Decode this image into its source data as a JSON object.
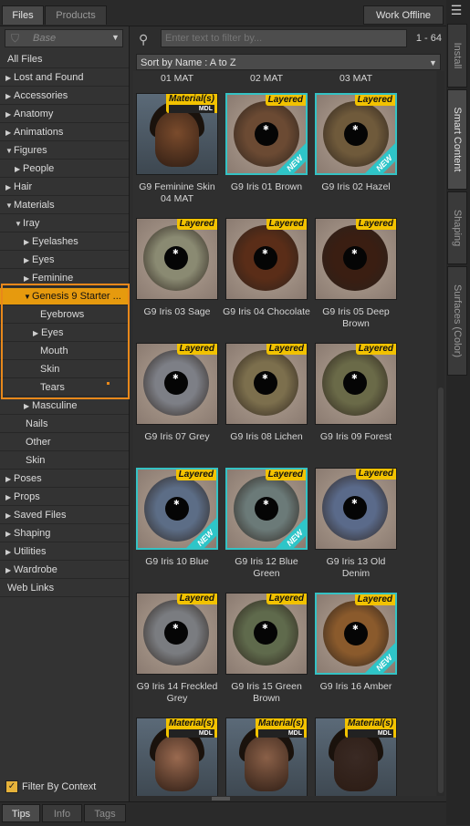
{
  "top_tabs": [
    {
      "label": "Files"
    },
    {
      "label": "Products"
    }
  ],
  "work_offline": "Work Offline",
  "filter_select": {
    "value": "Base"
  },
  "tree": [
    {
      "label": "All Files",
      "depth": 0,
      "arrow": ""
    },
    {
      "label": "Lost and Found",
      "depth": 0,
      "arrow": "▶"
    },
    {
      "label": "Accessories",
      "depth": 0,
      "arrow": "▶"
    },
    {
      "label": "Anatomy",
      "depth": 0,
      "arrow": "▶"
    },
    {
      "label": "Animations",
      "depth": 0,
      "arrow": "▶"
    },
    {
      "label": "Figures",
      "depth": 0,
      "arrow": "▼"
    },
    {
      "label": "People",
      "depth": 1,
      "arrow": "▶"
    },
    {
      "label": "Hair",
      "depth": 0,
      "arrow": "▶"
    },
    {
      "label": "Materials",
      "depth": 0,
      "arrow": "▼"
    },
    {
      "label": "Iray",
      "depth": 1,
      "arrow": "▼"
    },
    {
      "label": "Eyelashes",
      "depth": 2,
      "arrow": "▶"
    },
    {
      "label": "Eyes",
      "depth": 2,
      "arrow": "▶"
    },
    {
      "label": "Feminine",
      "depth": 2,
      "arrow": "▶"
    },
    {
      "label": "Genesis 9 Starter ...",
      "depth": 2,
      "arrow": "▼",
      "selected": true
    },
    {
      "label": "Eyebrows",
      "depth": 3,
      "arrow": ""
    },
    {
      "label": "Eyes",
      "depth": 3,
      "arrow": "▶"
    },
    {
      "label": "Mouth",
      "depth": 3,
      "arrow": ""
    },
    {
      "label": "Skin",
      "depth": 3,
      "arrow": ""
    },
    {
      "label": "Tears",
      "depth": 3,
      "arrow": ""
    },
    {
      "label": "Masculine",
      "depth": 2,
      "arrow": "▶"
    },
    {
      "label": "Nails",
      "depth": 2,
      "arrow": ""
    },
    {
      "label": "Other",
      "depth": 2,
      "arrow": ""
    },
    {
      "label": "Skin",
      "depth": 2,
      "arrow": ""
    },
    {
      "label": "Poses",
      "depth": 0,
      "arrow": "▶"
    },
    {
      "label": "Props",
      "depth": 0,
      "arrow": "▶"
    },
    {
      "label": "Saved Files",
      "depth": 0,
      "arrow": "▶"
    },
    {
      "label": "Shaping",
      "depth": 0,
      "arrow": "▶"
    },
    {
      "label": "Utilities",
      "depth": 0,
      "arrow": "▶"
    },
    {
      "label": "Wardrobe",
      "depth": 0,
      "arrow": "▶"
    },
    {
      "label": "Web Links",
      "depth": 0,
      "arrow": ""
    }
  ],
  "filter_by_context": {
    "label": "Filter By Context",
    "checked": true
  },
  "search": {
    "placeholder": "Enter text to filter by..."
  },
  "result_range": "1 - 64",
  "sort": {
    "value": "Sort by Name : A to Z"
  },
  "partial_labels": [
    "01 MAT",
    "02 MAT",
    "03 MAT"
  ],
  "items": [
    {
      "label": "G9 Feminine Skin 04 MAT",
      "kind": "person",
      "badge": "Material(s)",
      "badge_sub": "MDL",
      "teal": false,
      "new": false,
      "skin": "#7a4b2c"
    },
    {
      "label": "G9 Iris 01 Brown",
      "kind": "eye",
      "badge": "Layered",
      "teal": true,
      "new": true,
      "iris": "#6b4a33"
    },
    {
      "label": "G9 Iris 02 Hazel",
      "kind": "eye",
      "badge": "Layered",
      "teal": true,
      "new": true,
      "iris": "#6f5a3b"
    },
    {
      "label": "G9 Iris 03 Sage",
      "kind": "eye",
      "badge": "Layered",
      "teal": false,
      "new": false,
      "iris": "#8a8a72"
    },
    {
      "label": "G9 Iris 04 Chocolate",
      "kind": "eye",
      "badge": "Layered",
      "teal": false,
      "new": false,
      "iris": "#5a2d18"
    },
    {
      "label": "G9 Iris 05 Deep Brown",
      "kind": "eye",
      "badge": "Layered",
      "teal": false,
      "new": false,
      "iris": "#3a1e12"
    },
    {
      "label": "G9 Iris 07 Grey",
      "kind": "eye",
      "badge": "Layered",
      "teal": false,
      "new": false,
      "iris": "#7d7f86"
    },
    {
      "label": "G9 Iris 08 Lichen",
      "kind": "eye",
      "badge": "Layered",
      "teal": false,
      "new": false,
      "iris": "#7c6f4d"
    },
    {
      "label": "G9 Iris 09 Forest",
      "kind": "eye",
      "badge": "Layered",
      "teal": false,
      "new": false,
      "iris": "#6a6a48"
    },
    {
      "label": "G9 Iris 10 Blue",
      "kind": "eye",
      "badge": "Layered",
      "teal": true,
      "new": true,
      "iris": "#5c6d86"
    },
    {
      "label": "G9 Iris 12 Blue Green",
      "kind": "eye",
      "badge": "Layered",
      "teal": true,
      "new": true,
      "iris": "#6b7a78"
    },
    {
      "label": "G9 Iris 13 Old Denim",
      "kind": "eye",
      "badge": "Layered",
      "teal": false,
      "new": false,
      "iris": "#5a6a8a"
    },
    {
      "label": "G9 Iris 14 Freckled Grey",
      "kind": "eye",
      "badge": "Layered",
      "teal": false,
      "new": false,
      "iris": "#7a7c80"
    },
    {
      "label": "G9 Iris 15 Green Brown",
      "kind": "eye",
      "badge": "Layered",
      "teal": false,
      "new": false,
      "iris": "#5f6a4c"
    },
    {
      "label": "G9 Iris 16 Amber",
      "kind": "eye",
      "badge": "Layered",
      "teal": true,
      "new": true,
      "iris": "#8a5a2c"
    },
    {
      "label": "",
      "kind": "person",
      "badge": "Material(s)",
      "badge_sub": "MDL",
      "teal": false,
      "new": false,
      "skin": "#9a6a50"
    },
    {
      "label": "",
      "kind": "person",
      "badge": "Material(s)",
      "badge_sub": "MDL",
      "teal": false,
      "new": false,
      "skin": "#8a6048"
    },
    {
      "label": "",
      "kind": "person",
      "badge": "Material(s)",
      "badge_sub": "MDL",
      "teal": false,
      "new": false,
      "skin": "#3a2a24"
    }
  ],
  "new_tag": "NEW",
  "right_tabs": [
    {
      "label": "Install",
      "active": false
    },
    {
      "label": "Smart Content",
      "active": true
    },
    {
      "label": "Shaping",
      "active": false
    },
    {
      "label": "Surfaces (Color)",
      "active": false
    }
  ],
  "bottom_tabs": [
    {
      "label": "Tips",
      "active": true
    },
    {
      "label": "Info",
      "active": false
    },
    {
      "label": "Tags",
      "active": false
    }
  ],
  "colors": {
    "accent": "#e69a0e",
    "highlight": "#e8881a",
    "new_teal": "#34c2c4",
    "badge": "#f2c200"
  }
}
